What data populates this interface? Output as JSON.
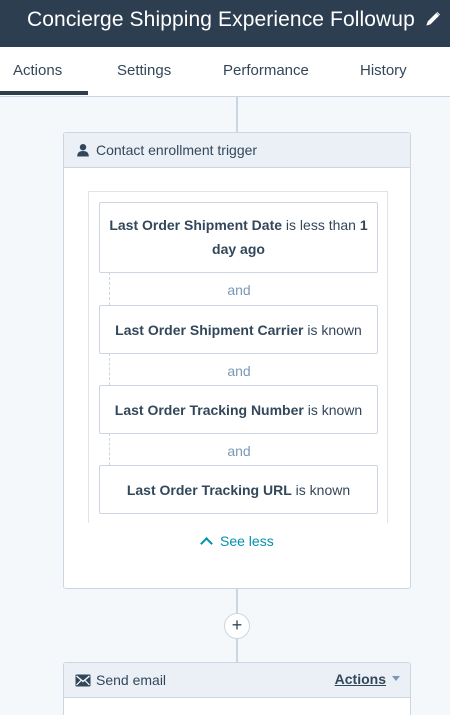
{
  "header": {
    "title": "Concierge Shipping Experience Followup",
    "edit_icon": "pencil-icon"
  },
  "tabs": [
    {
      "label": "Actions",
      "active": true
    },
    {
      "label": "Settings",
      "active": false
    },
    {
      "label": "Performance",
      "active": false
    },
    {
      "label": "History",
      "active": false
    }
  ],
  "trigger": {
    "title": "Contact enrollment trigger",
    "icon": "contact-icon",
    "filters": [
      {
        "property": "Last Order Shipment Date",
        "operator": "is less than",
        "value": "1 day ago"
      },
      {
        "property": "Last Order Shipment Carrier",
        "operator": "is known"
      },
      {
        "property": "Last Order Tracking Number",
        "operator": "is known"
      },
      {
        "property": "Last Order Tracking URL",
        "operator": "is known"
      }
    ],
    "joiner": "and",
    "toggle_label": "See less"
  },
  "add_action": {
    "label": "+"
  },
  "action": {
    "title": "Send email",
    "icon": "envelope-icon",
    "menu_label": "Actions"
  },
  "colors": {
    "header_bg": "#2d3e50",
    "link": "#0091ae",
    "card_header_bg": "#eaf0f6",
    "border": "#cbd6e2"
  }
}
